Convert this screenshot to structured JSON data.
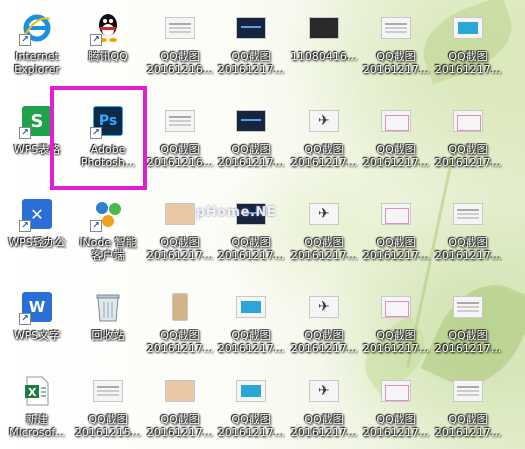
{
  "desktop": {
    "watermark": "pHome.NE",
    "icons": [
      {
        "label_1": "Internet",
        "label_2": "Explorer",
        "icon": "ie-icon"
      },
      {
        "label_1": "腾讯QQ",
        "label_2": "",
        "icon": "qq-icon"
      },
      {
        "label_1": "QQ截图",
        "label_2": "20161216...",
        "icon": "image-file-icon"
      },
      {
        "label_1": "QQ截图",
        "label_2": "20161217...",
        "icon": "image-file-icon"
      },
      {
        "label_1": "11080416...",
        "label_2": "",
        "icon": "image-file-icon"
      },
      {
        "label_1": "QQ截图",
        "label_2": "20161217...",
        "icon": "image-file-icon"
      },
      {
        "label_1": "QQ截图",
        "label_2": "20161217...",
        "icon": "image-file-icon"
      },
      {
        "label_1": "WPS表格",
        "label_2": "",
        "icon": "wps-sheets-icon"
      },
      {
        "label_1": "Adobe",
        "label_2": "Photosh...",
        "icon": "photoshop-icon"
      },
      {
        "label_1": "QQ截图",
        "label_2": "20161216...",
        "icon": "image-file-icon"
      },
      {
        "label_1": "QQ截图",
        "label_2": "20161217...",
        "icon": "image-file-icon"
      },
      {
        "label_1": "QQ截图",
        "label_2": "20161217...",
        "icon": "image-file-icon"
      },
      {
        "label_1": "QQ截图",
        "label_2": "20161217...",
        "icon": "image-file-icon"
      },
      {
        "label_1": "QQ截图",
        "label_2": "20161217...",
        "icon": "image-file-icon"
      },
      {
        "label_1": "WPS轻办公",
        "label_2": "",
        "icon": "wps-office-icon"
      },
      {
        "label_1": "iNode 智能",
        "label_2": "客户端",
        "icon": "inode-icon"
      },
      {
        "label_1": "QQ截图",
        "label_2": "20161217...",
        "icon": "image-file-icon"
      },
      {
        "label_1": "QQ截图",
        "label_2": "20161217...",
        "icon": "image-file-icon"
      },
      {
        "label_1": "QQ截图",
        "label_2": "20161217...",
        "icon": "image-file-icon"
      },
      {
        "label_1": "QQ截图",
        "label_2": "20161217...",
        "icon": "image-file-icon"
      },
      {
        "label_1": "QQ截图",
        "label_2": "20161217...",
        "icon": "image-file-icon"
      },
      {
        "label_1": "WPS文字",
        "label_2": "",
        "icon": "wps-writer-icon"
      },
      {
        "label_1": "回收站",
        "label_2": "",
        "icon": "recycle-bin-icon"
      },
      {
        "label_1": "QQ截图",
        "label_2": "20161217...",
        "icon": "image-file-icon"
      },
      {
        "label_1": "QQ截图",
        "label_2": "20161217...",
        "icon": "image-file-icon"
      },
      {
        "label_1": "QQ截图",
        "label_2": "20161217...",
        "icon": "image-file-icon"
      },
      {
        "label_1": "QQ截图",
        "label_2": "20161217...",
        "icon": "image-file-icon"
      },
      {
        "label_1": "QQ截图",
        "label_2": "20161217...",
        "icon": "image-file-icon"
      },
      {
        "label_1": "新建",
        "label_2": "Microsof...",
        "icon": "excel-file-icon"
      },
      {
        "label_1": "QQ截图",
        "label_2": "20161215...",
        "icon": "image-file-icon"
      },
      {
        "label_1": "QQ截图",
        "label_2": "20161217...",
        "icon": "image-file-icon"
      },
      {
        "label_1": "QQ截图",
        "label_2": "20161217...",
        "icon": "image-file-icon"
      },
      {
        "label_1": "QQ截图",
        "label_2": "20161217...",
        "icon": "image-file-icon"
      },
      {
        "label_1": "QQ截图",
        "label_2": "20161217...",
        "icon": "image-file-icon"
      },
      {
        "label_1": "QQ截图",
        "label_2": "20161217...",
        "icon": "image-file-icon"
      }
    ],
    "colors": {
      "highlight": "#e21fcf",
      "photoshop_bg": "#0d2a44",
      "photoshop_text": "#31a8ff",
      "wps_green": "#1ea24a",
      "wps_blue": "#2a6fd6"
    }
  }
}
